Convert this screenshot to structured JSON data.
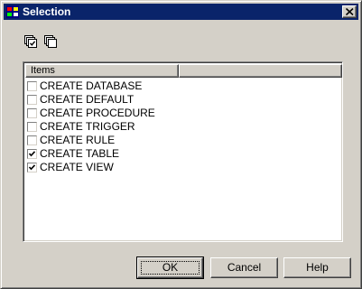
{
  "window": {
    "title": "Selection"
  },
  "toolbar": {
    "icons": [
      "select-all-icon",
      "deselect-all-icon"
    ]
  },
  "list": {
    "columns": [
      "Items",
      ""
    ],
    "items": [
      {
        "label": "CREATE DATABASE",
        "checked": false
      },
      {
        "label": "CREATE DEFAULT",
        "checked": false
      },
      {
        "label": "CREATE PROCEDURE",
        "checked": false
      },
      {
        "label": "CREATE TRIGGER",
        "checked": false
      },
      {
        "label": "CREATE RULE",
        "checked": false
      },
      {
        "label": "CREATE TABLE",
        "checked": true
      },
      {
        "label": "CREATE VIEW",
        "checked": true
      }
    ]
  },
  "buttons": {
    "ok": "OK",
    "cancel": "Cancel",
    "help": "Help"
  },
  "colors": {
    "titlebar": "#0a246a",
    "face": "#d4d0c8",
    "list_bg": "#ffffff"
  }
}
